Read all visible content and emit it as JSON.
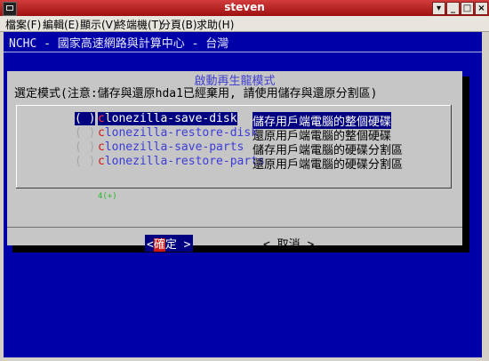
{
  "window": {
    "title": "steven",
    "buttons": [
      "▾",
      "_",
      "□",
      "×"
    ]
  },
  "menu": {
    "items": [
      "檔案(F)",
      "編輯(E)",
      "顯示(V)",
      "終端機(T)",
      "分頁(B)",
      "求助(H)"
    ]
  },
  "terminal": {
    "header": "NCHC - 國家高速網路與計算中心 - 台灣"
  },
  "dialog": {
    "title": "啟動再生龍模式",
    "prompt": "選定模式(注意:儲存與還原hda1已經棄用, 請使用儲存與還原分割區)",
    "options": [
      {
        "check": "( )",
        "hot": "c",
        "tag": "lonezilla-save-disk",
        "desc": "儲存用戶端電腦的整個硬碟"
      },
      {
        "check": "( )",
        "hot": "c",
        "tag": "lonezilla-restore-disk",
        "desc": "還原用戶端電腦的整個硬碟"
      },
      {
        "check": "( )",
        "hot": "c",
        "tag": "lonezilla-save-parts",
        "desc": "儲存用戶端電腦的硬碟分割區"
      },
      {
        "check": "( )",
        "hot": "c",
        "tag": "lonezilla-restore-parts",
        "desc": "還原用戶端電腦的硬碟分割區"
      }
    ],
    "scroll_indicator": "4(+)",
    "ok_left": "<",
    "ok_hot": "確",
    "ok_rest": "定 >",
    "cancel": "< 取消 >"
  }
}
